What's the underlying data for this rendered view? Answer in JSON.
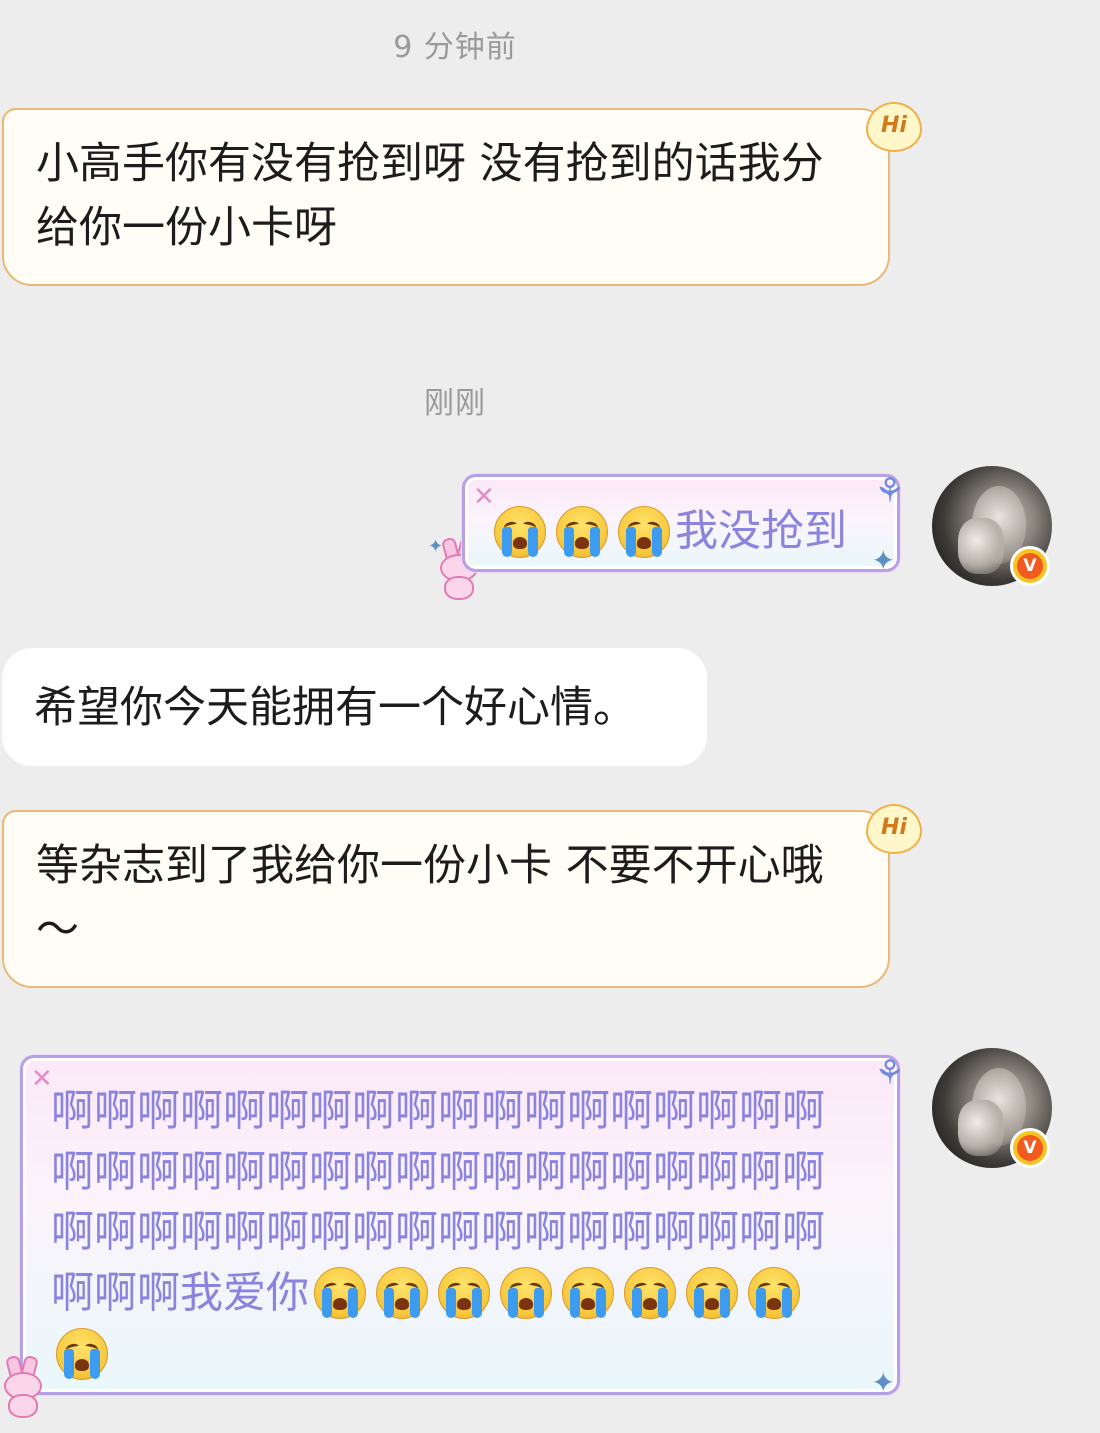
{
  "messages": {
    "time_1": "9 分钟前",
    "msg_1": "小高手你有没有抢到呀 没有抢到的话我分给你一份小卡呀",
    "time_2": "刚刚",
    "msg_2_text": "我没抢到",
    "msg_3": "希望你今天能拥有一个好心情。",
    "msg_4": "等杂志到了我给你一份小卡 不要不开心哦～",
    "msg_5_text": "啊啊啊啊啊啊啊啊啊啊啊啊啊啊啊啊啊啊啊啊啊啊啊啊啊啊啊啊啊啊啊啊啊啊啊啊啊啊啊啊啊啊啊啊啊啊啊啊啊啊啊啊啊啊啊啊啊我爱你",
    "hi_badge": "Hi",
    "vip_badge": "V"
  },
  "icons": {
    "crying": "loudly-crying-face-icon",
    "bubble_decor": [
      "bow-ribbon-icon",
      "sparkle-icon",
      "bunny-sticker-icon",
      "cross-icon"
    ],
    "avatar_badge": "verified-v-icon"
  },
  "colors": {
    "background": "#ededed",
    "cream_bubble": "#fffdf5",
    "cream_border": "#e8b978",
    "pink_text": "#8a84de",
    "timestamp": "#9a9a9a"
  }
}
